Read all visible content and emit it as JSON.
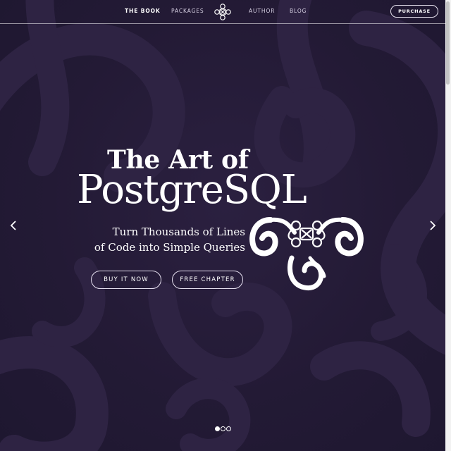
{
  "nav": {
    "items": [
      {
        "label": "THE BOOK",
        "active": true
      },
      {
        "label": "PACKAGES",
        "active": false
      },
      {
        "label": "AUTHOR",
        "active": false
      },
      {
        "label": "BLOG",
        "active": false
      }
    ],
    "logo_icon": "celtic-knot-icon",
    "purchase_label": "PURCHASE"
  },
  "hero": {
    "title_line1": "The Art of",
    "title_line2": "PostgreSQL",
    "subtitle_line1": "Turn Thousands of Lines",
    "subtitle_line2": "of Code into Simple Queries",
    "buy_label": "BUY IT NOW",
    "free_label": "FREE CHAPTER",
    "knot_icon": "celtic-knot-illustration"
  },
  "carousel": {
    "prev_icon": "chevron-left-icon",
    "next_icon": "chevron-right-icon",
    "slide_count": 3,
    "active_slide": 1
  },
  "colors": {
    "background": "#221a33",
    "swirl": "#2e2343",
    "text": "#ffffff"
  }
}
